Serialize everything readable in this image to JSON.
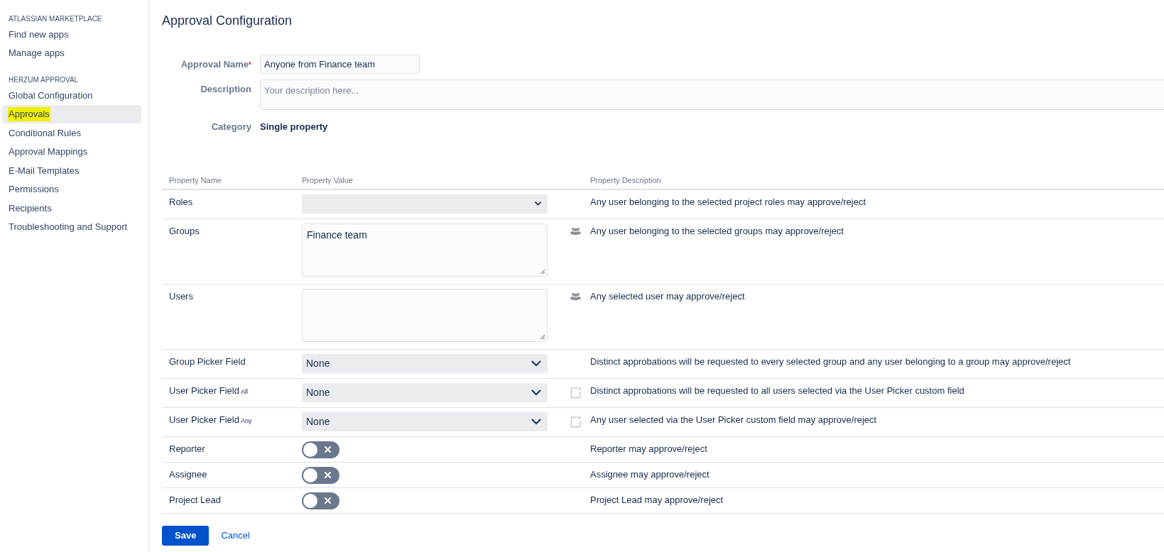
{
  "sidebar": {
    "sections": [
      {
        "heading": "ATLASSIAN MARKETPLACE",
        "items": [
          {
            "label": "Find new apps",
            "selected": false,
            "highlighted": false
          },
          {
            "label": "Manage apps",
            "selected": false,
            "highlighted": false
          }
        ]
      },
      {
        "heading": "HERZUM APPROVAL",
        "items": [
          {
            "label": "Global Configuration",
            "selected": false,
            "highlighted": false
          },
          {
            "label": "Approvals",
            "selected": true,
            "highlighted": true
          },
          {
            "label": "Conditional Rules",
            "selected": false,
            "highlighted": false
          },
          {
            "label": "Approval Mappings",
            "selected": false,
            "highlighted": false
          },
          {
            "label": "E-Mail Templates",
            "selected": false,
            "highlighted": false
          },
          {
            "label": "Permissions",
            "selected": false,
            "highlighted": false
          },
          {
            "label": "Recipients",
            "selected": false,
            "highlighted": false
          },
          {
            "label": "Troubleshooting and Support",
            "selected": false,
            "highlighted": false
          }
        ]
      }
    ]
  },
  "page": {
    "title": "Approval Configuration",
    "form": {
      "name_label": "Approval Name",
      "required_mark": "*",
      "name_value": "Anyone from Finance team",
      "description_label": "Description",
      "description_placeholder": "Your description here...",
      "category_label": "Category",
      "category_value": "Single property"
    },
    "table": {
      "columns": [
        "Property Name",
        "Property Value",
        "Property Description"
      ],
      "rows": [
        {
          "name": "Roles",
          "kind": "select",
          "value": "",
          "description": "Any user belonging to the selected project roles may approve/reject"
        },
        {
          "name": "Groups",
          "kind": "textarea",
          "value": "Finance team",
          "description": "Any user belonging to the selected groups may approve/reject"
        },
        {
          "name": "Users",
          "kind": "textarea",
          "value": "",
          "description": "Any selected user may approve/reject"
        },
        {
          "name": "Group Picker Field",
          "kind": "select",
          "value": "None",
          "description": "Distinct approbations will be requested to every selected group and any user belonging to a group may approve/reject"
        },
        {
          "name": "User Picker Field",
          "suffix": "All",
          "kind": "select",
          "value": "None",
          "description": "Distinct approbations will be requested to all users selected via the User Picker custom field"
        },
        {
          "name": "User Picker Field",
          "suffix": "Any",
          "kind": "select",
          "value": "None",
          "description": "Any user selected via the User Picker custom field may approve/reject"
        },
        {
          "name": "Reporter",
          "kind": "toggle",
          "on": false,
          "description": "Reporter may approve/reject"
        },
        {
          "name": "Assignee",
          "kind": "toggle",
          "on": false,
          "description": "Assignee may approve/reject"
        },
        {
          "name": "Project Lead",
          "kind": "toggle",
          "on": false,
          "description": "Project Lead may approve/reject"
        }
      ]
    },
    "buttons": {
      "save": "Save",
      "cancel": "Cancel"
    }
  }
}
